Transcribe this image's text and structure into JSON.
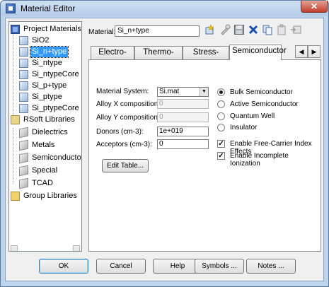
{
  "window": {
    "title": "Material Editor",
    "close_glyph": "✕"
  },
  "tree": {
    "items": [
      {
        "label": "Project Materials",
        "icon": "project-icon",
        "level": 0
      },
      {
        "label": "SiO2",
        "icon": "material-icon",
        "level": 1
      },
      {
        "label": "Si_n+type",
        "icon": "material-icon",
        "level": 1,
        "selected": true
      },
      {
        "label": "Si_ntype",
        "icon": "material-icon",
        "level": 1
      },
      {
        "label": "Si_ntypeCore",
        "icon": "material-icon",
        "level": 1
      },
      {
        "label": "Si_p+type",
        "icon": "material-icon",
        "level": 1
      },
      {
        "label": "Si_ptype",
        "icon": "material-icon",
        "level": 1
      },
      {
        "label": "Si_ptypeCore",
        "icon": "material-icon",
        "level": 1
      },
      {
        "label": "RSoft Libraries",
        "icon": "folder-icon",
        "level": 0
      },
      {
        "label": "Dielectrics",
        "icon": "library-icon",
        "level": 1
      },
      {
        "label": "Metals",
        "icon": "library-icon",
        "level": 1
      },
      {
        "label": "Semiconductors",
        "icon": "library-icon",
        "level": 1
      },
      {
        "label": "Special",
        "icon": "library-icon",
        "level": 1
      },
      {
        "label": "TCAD",
        "icon": "library-icon",
        "level": 1
      },
      {
        "label": "Group Libraries",
        "icon": "folder-open-icon",
        "level": 0
      }
    ]
  },
  "material": {
    "label": "Material:",
    "value": "Si_n+type"
  },
  "tabs": [
    {
      "label": "Electro-Optic"
    },
    {
      "label": "Thermo-Optic"
    },
    {
      "label": "Stress-Optic"
    },
    {
      "label": "Semiconductor",
      "active": true
    }
  ],
  "semiconductor": {
    "material_system_label": "Material System:",
    "material_system_value": "Si.mat",
    "alloy_x_label": "Alloy X composition:",
    "alloy_x_value": "0",
    "alloy_y_label": "Alloy Y composition:",
    "alloy_y_value": "0",
    "donors_label": "Donors (cm-3):",
    "donors_value": "1e+019",
    "acceptors_label": "Acceptors (cm-3):",
    "acceptors_value": "0",
    "edit_table_label": "Edit Table...",
    "radio_options": [
      {
        "label": "Bulk Semiconductor",
        "checked": true
      },
      {
        "label": "Active Semiconductor",
        "checked": false
      },
      {
        "label": "Quantum Well",
        "checked": false
      },
      {
        "label": "Insulator",
        "checked": false
      }
    ],
    "check_options": [
      {
        "label": "Enable Free-Carrier Index Effects",
        "checked": true
      },
      {
        "label": "Enable Incomplete Ionization",
        "checked": true
      }
    ]
  },
  "footer": {
    "ok": "OK",
    "cancel": "Cancel",
    "help": "Help",
    "symbols": "Symbols ...",
    "notes": "Notes ..."
  }
}
